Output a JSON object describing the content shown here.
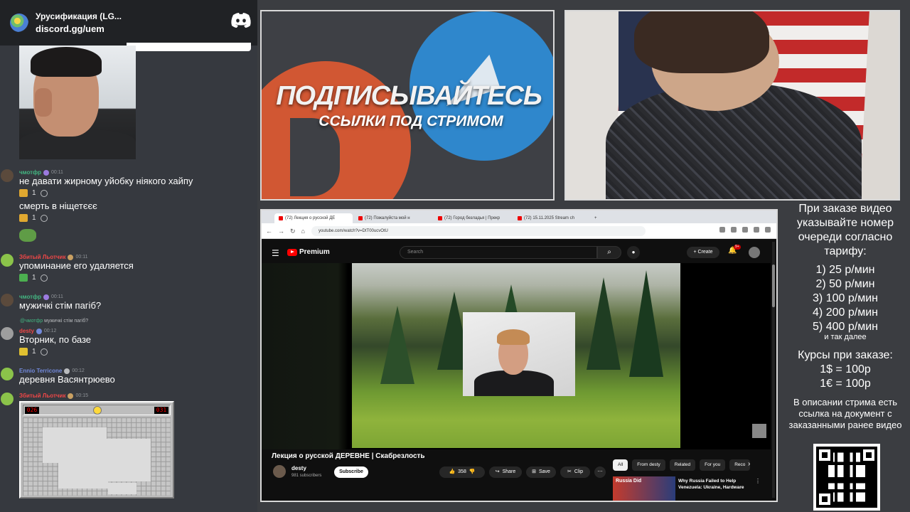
{
  "discord": {
    "server_name": "Урусификация (LG...",
    "server_link": "discord.gg/uem",
    "messages": [
      {
        "user": "чмотфр",
        "time": "00:11",
        "text": "не давати жирному уйобку ніякого хайпу",
        "reaction_count": "1"
      },
      {
        "text": "смерть в ніщетєєє",
        "reaction_count": "1"
      },
      {
        "user": "Збитый Льотчик",
        "time": "00:11",
        "text": "упоминание его удаляется",
        "reaction_count": "1"
      },
      {
        "user": "чмотфр",
        "time": "00:11",
        "text": "мужичкі стім пагіб?"
      },
      {
        "reply_user": "@чмотфр",
        "reply_text": "мужичкі стім пагіб?",
        "user": "desty",
        "time": "00:12",
        "text": "Вторник, по базе",
        "reaction_count": "1"
      },
      {
        "user": "Ennio Terricone",
        "time": "00:12",
        "text": "деревня Васянтрюево"
      },
      {
        "user": "Збитый Льотчик",
        "time": "00:15"
      }
    ],
    "minesweeper": {
      "mines_left": "026",
      "timer": "031"
    }
  },
  "promo": {
    "headline": "ПОДПИСЫВАЙТЕСЬ",
    "subline": "ССЫЛКИ ПОД СТРИМОМ"
  },
  "browser": {
    "tabs": [
      "(72) Лекция о русской ДЕ",
      "(72) Пожалуйста мой н",
      "(72) Город безладья | Прекр",
      "(72) 15.11.2025 Stream ch"
    ],
    "url": "youtube.com/watch?v=DtT00ucvOtU",
    "yt_brand": "Premium",
    "search_placeholder": "Search",
    "create_label": "Create",
    "notif_count": "9+",
    "video_title": "Лекция о русской ДЕРЕВНЕ | Скабрезлость",
    "channel": "desty",
    "subscribers": "981 subscribers",
    "subscribe_label": "Subscribe",
    "likes": "358",
    "share_label": "Share",
    "save_label": "Save",
    "clip_label": "Clip",
    "chips": [
      "All",
      "From desty",
      "Related",
      "For you",
      "Reco"
    ],
    "rec_thumb_text": "Russia Did",
    "rec_title": "Why Russia Failed to Help Venezuela: Ukraine, Hardware"
  },
  "info": {
    "header": "При заказе видео указывайте номер очереди согласно тарифу:",
    "prices": [
      "1) 25 р/мин",
      "2) 50 р/мин",
      "3) 100 р/мин",
      "4) 200 р/мин",
      "5) 400 р/мин"
    ],
    "price_note": "и так далее",
    "courses_header": "Курсы при заказе:",
    "courses": [
      "1$ = 100р",
      "1€ = 100р"
    ],
    "description": "В описании стрима есть ссылка на документ с заказанными ранее видео"
  },
  "colors": {
    "discord_bg": "#36393f",
    "username_green": "#43b581",
    "username_red": "#f04747",
    "username_blue": "#7289da",
    "yt_red": "#ff0000",
    "promo_orange": "#d15733",
    "promo_blue": "#2f87cc"
  }
}
